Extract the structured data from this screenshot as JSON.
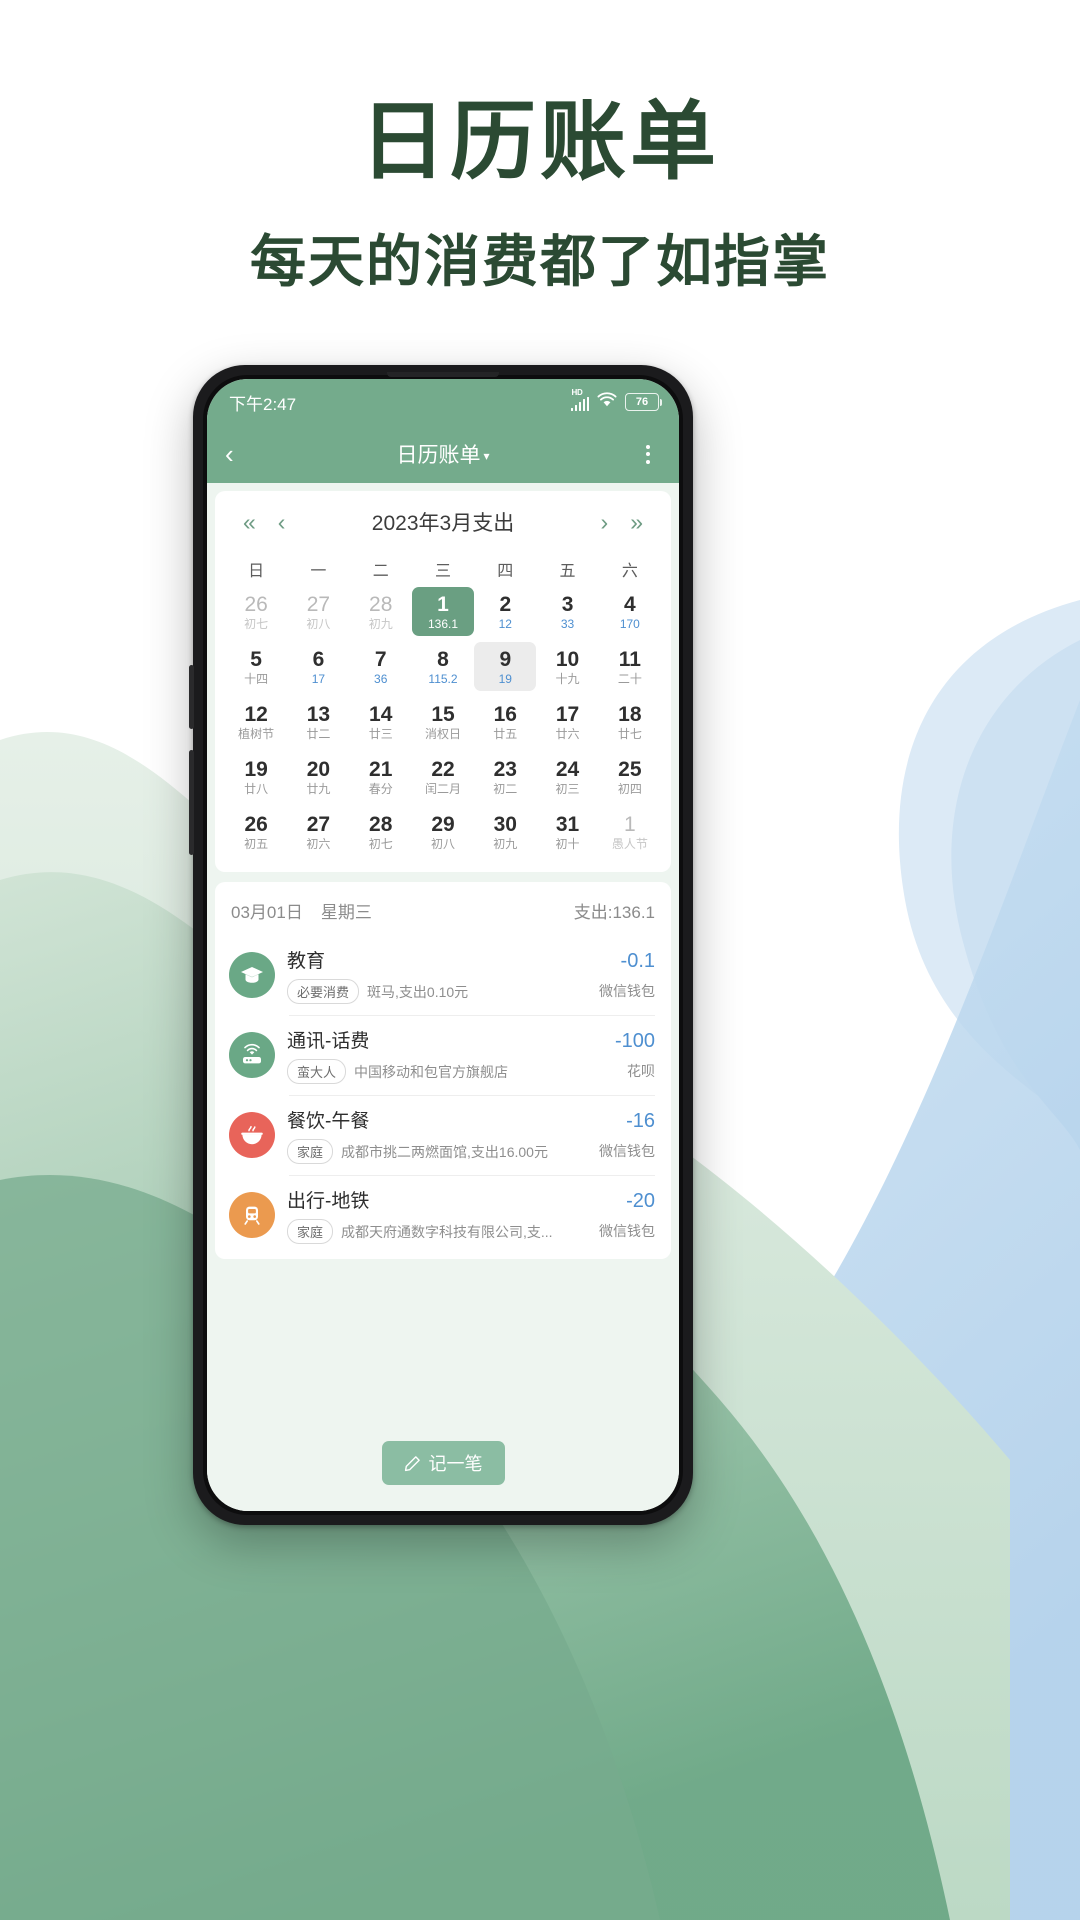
{
  "promo": {
    "title": "日历账单",
    "subtitle": "每天的消费都了如指掌"
  },
  "colors": {
    "brand_green": "#74ab8c",
    "dark_green": "#2b4a33",
    "amount_blue": "#4e8fd0",
    "selected_day": "#6a9f82"
  },
  "statusbar": {
    "time": "下午2:47",
    "network_label": "HD",
    "battery": "76",
    "icons": [
      "signal-icon",
      "wifi-icon",
      "battery-icon"
    ]
  },
  "appbar": {
    "back": "‹",
    "title": "日历账单",
    "caret": "▾",
    "more": "more-vertical-icon"
  },
  "calendar": {
    "nav": {
      "first": "«",
      "prev": "‹",
      "next": "›",
      "last": "»"
    },
    "month_title": "2023年3月支出",
    "weekdays": [
      "日",
      "一",
      "二",
      "三",
      "四",
      "五",
      "六"
    ],
    "days": [
      {
        "d": "26",
        "s": "初七",
        "state": "out"
      },
      {
        "d": "27",
        "s": "初八",
        "state": "out"
      },
      {
        "d": "28",
        "s": "初九",
        "state": "out"
      },
      {
        "d": "1",
        "s": "136.1",
        "state": "sel"
      },
      {
        "d": "2",
        "s": "12",
        "state": "amt"
      },
      {
        "d": "3",
        "s": "33",
        "state": "amt"
      },
      {
        "d": "4",
        "s": "170",
        "state": "amt"
      },
      {
        "d": "5",
        "s": "十四",
        "state": ""
      },
      {
        "d": "6",
        "s": "17",
        "state": "amt"
      },
      {
        "d": "7",
        "s": "36",
        "state": "amt"
      },
      {
        "d": "8",
        "s": "115.2",
        "state": "amt"
      },
      {
        "d": "9",
        "s": "19",
        "state": "today-amt"
      },
      {
        "d": "10",
        "s": "十九",
        "state": ""
      },
      {
        "d": "11",
        "s": "二十",
        "state": ""
      },
      {
        "d": "12",
        "s": "植树节",
        "state": ""
      },
      {
        "d": "13",
        "s": "廿二",
        "state": ""
      },
      {
        "d": "14",
        "s": "廿三",
        "state": ""
      },
      {
        "d": "15",
        "s": "消权日",
        "state": ""
      },
      {
        "d": "16",
        "s": "廿五",
        "state": ""
      },
      {
        "d": "17",
        "s": "廿六",
        "state": ""
      },
      {
        "d": "18",
        "s": "廿七",
        "state": ""
      },
      {
        "d": "19",
        "s": "廿八",
        "state": ""
      },
      {
        "d": "20",
        "s": "廿九",
        "state": ""
      },
      {
        "d": "21",
        "s": "春分",
        "state": ""
      },
      {
        "d": "22",
        "s": "闰二月",
        "state": ""
      },
      {
        "d": "23",
        "s": "初二",
        "state": ""
      },
      {
        "d": "24",
        "s": "初三",
        "state": ""
      },
      {
        "d": "25",
        "s": "初四",
        "state": ""
      },
      {
        "d": "26",
        "s": "初五",
        "state": ""
      },
      {
        "d": "27",
        "s": "初六",
        "state": ""
      },
      {
        "d": "28",
        "s": "初七",
        "state": ""
      },
      {
        "d": "29",
        "s": "初八",
        "state": ""
      },
      {
        "d": "30",
        "s": "初九",
        "state": ""
      },
      {
        "d": "31",
        "s": "初十",
        "state": ""
      },
      {
        "d": "1",
        "s": "愚人节",
        "state": "out"
      }
    ]
  },
  "day_detail": {
    "date": "03月01日",
    "weekday": "星期三",
    "total": "支出:136.1",
    "transactions": [
      {
        "icon": "graduation-cap-icon",
        "icon_color": "#6aa886",
        "title": "教育",
        "tag": "必要消费",
        "note": "斑马,支出0.10元",
        "amount": "-0.1",
        "account": "微信钱包"
      },
      {
        "icon": "router-icon",
        "icon_color": "#6aa886",
        "title": "通讯-话费",
        "tag": "蛮大人",
        "note": "中国移动和包官方旗舰店",
        "amount": "-100",
        "account": "花呗"
      },
      {
        "icon": "food-bowl-icon",
        "icon_color": "#e8645a",
        "title": "餐饮-午餐",
        "tag": "家庭",
        "note": "成都市挑二两燃面馆,支出16.00元",
        "amount": "-16",
        "account": "微信钱包"
      },
      {
        "icon": "subway-icon",
        "icon_color": "#eb9a4f",
        "title": "出行-地铁",
        "tag": "家庭",
        "note": "成都天府通数字科技有限公司,支...",
        "amount": "-20",
        "account": "微信钱包"
      }
    ]
  },
  "fab": {
    "icon": "pencil-icon",
    "label": "记一笔"
  }
}
